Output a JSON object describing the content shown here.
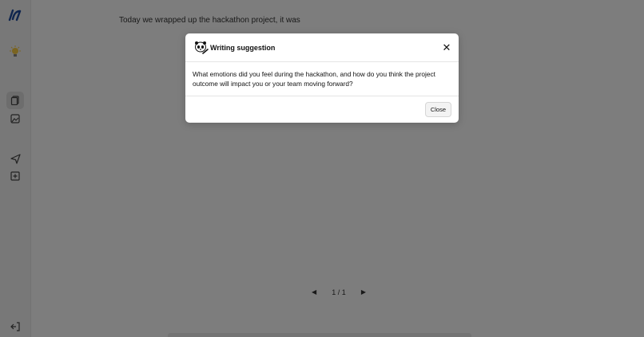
{
  "editor": {
    "text": "Today we wrapped up the hackathon project, it was"
  },
  "pager": {
    "prev_icon": "chevron-left-icon",
    "label": "1 / 1",
    "next_icon": "chevron-right-icon"
  },
  "sidebar": {
    "items": [
      {
        "name": "logo",
        "icon": "brand-logo-icon"
      },
      {
        "name": "idea",
        "icon": "lightbulb-icon"
      },
      {
        "name": "documents",
        "icon": "document-copy-icon",
        "active": true
      },
      {
        "name": "images",
        "icon": "image-icon"
      },
      {
        "name": "send",
        "icon": "send-icon"
      },
      {
        "name": "add",
        "icon": "plus-square-icon"
      },
      {
        "name": "logout",
        "icon": "logout-icon"
      }
    ]
  },
  "modal": {
    "title": "Writing suggestion",
    "logo_icon": "panda-writing-icon",
    "close_icon": "close-icon",
    "body": "What emotions did you feel during the hackathon, and how do you think the project outcome will impact you or your team moving forward?",
    "close_button": "Close"
  },
  "colors": {
    "overlay": "rgba(0,0,0,0.5)",
    "logo_blue": "#1e4a9c",
    "bulb_yellow": "#f5c842"
  }
}
